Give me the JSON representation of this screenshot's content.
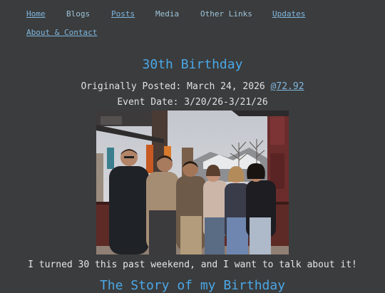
{
  "nav": {
    "home": "Home",
    "blogs": "Blogs",
    "posts": "Posts",
    "media": "Media",
    "other_links": "Other Links",
    "updates": "Updates",
    "about": "About & Contact"
  },
  "post": {
    "title": "30th Birthday",
    "posted_prefix": "Originally Posted: March 24, 2026",
    "posted_link": "@72.92",
    "event_date": "Event Date: 3/20/26-3/21/26",
    "caption": "I turned 30 this past weekend, and I want to talk about it!",
    "section_heading": "The Story of my Birthday"
  },
  "colors": {
    "background": "#3b3c3d",
    "accent": "#4aa8e8",
    "link": "#7fb7e0"
  }
}
